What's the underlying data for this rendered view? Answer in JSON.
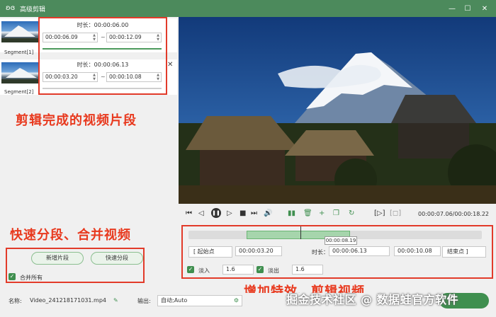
{
  "window": {
    "title": "高级剪辑"
  },
  "segments": [
    {
      "label": "Segment[1]",
      "duration_label": "时长：",
      "duration": "00:00:06.00",
      "start": "00:00:06.09",
      "end": "00:00:12.09"
    },
    {
      "label": "Segment[2]",
      "duration_label": "时长：",
      "duration": "00:00:06.13",
      "start": "00:00:03.20",
      "end": "00:00:10.08"
    }
  ],
  "annotations": {
    "segments_done": "剪辑完成的视频片段",
    "split_merge": "快速分段、合并视频",
    "effects_cut": "增加特效、剪辑视频"
  },
  "left_actions": {
    "add_segment": "新增片段",
    "quick_split": "快速分段",
    "merge_all": "合并所有"
  },
  "player": {
    "time_readout": "00:00:07.06/00:00:18.22"
  },
  "timeline": {
    "tooltip": "00:00:08.19"
  },
  "trim": {
    "start_point": "起始点",
    "start_value": "00:00:03.20",
    "duration_label": "时长：",
    "duration_value": "00:00:06.13",
    "end_value": "00:00:10.08",
    "end_point": "结束点"
  },
  "fades": {
    "fade_in_label": "淡入",
    "fade_in_value": "1.6",
    "fade_out_label": "淡出",
    "fade_out_value": "1.6"
  },
  "footer": {
    "name_label": "名称:",
    "name_value": "Video_241218171031.mp4",
    "output_label": "输出:",
    "output_value": "自动;Auto"
  },
  "watermark": "掘金技术社区 @ 数据蛙官方软件",
  "icons": {
    "logo": "rabbit-logo-icon",
    "minimize": "minimize-icon",
    "maximize": "maximize-icon",
    "close": "close-icon",
    "edit": "pencil-icon",
    "settings": "gear-icon"
  },
  "colors": {
    "brand": "#4c8a5c",
    "accent": "#3f8f4f",
    "annotation": "#e8391e"
  }
}
